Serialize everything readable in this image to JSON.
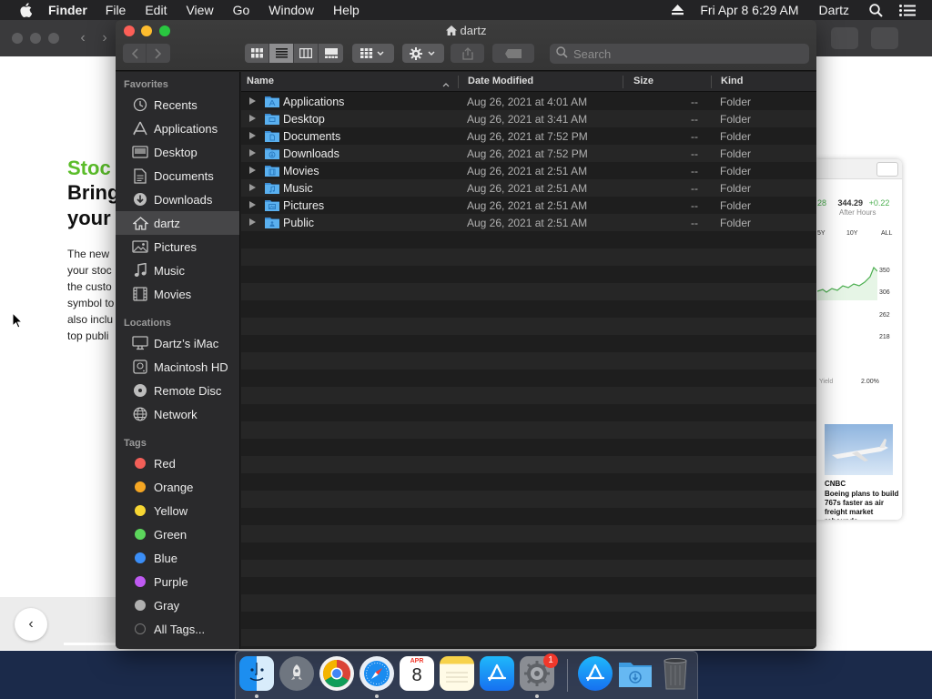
{
  "menubar": {
    "app_name": "Finder",
    "items": [
      "File",
      "Edit",
      "View",
      "Go",
      "Window",
      "Help"
    ],
    "clock": "Fri Apr 8  6:29 AM",
    "user": "Dartz"
  },
  "background_page": {
    "kicker": "Stoc",
    "headline_1": "Bring",
    "headline_2": "your",
    "body_lines": [
      "The new",
      "your stoc",
      "the custo",
      "symbol to",
      "also inclu",
      "top publi"
    ],
    "back_arrow": "‹",
    "stock_card": {
      "change_left": "28",
      "price": "344.29",
      "change": "+0.22",
      "after_hours": "After Hours",
      "ranges": [
        "5Y",
        "10Y",
        "ALL"
      ],
      "y_ticks": [
        "350",
        "306",
        "262",
        "218"
      ],
      "yield_label": "Yield",
      "yield_value": "2.00%",
      "news_source": "CNBC",
      "news_headline": "Boeing plans to build 767s faster as air freight market rebounds"
    }
  },
  "finder": {
    "window_title": "dartz",
    "search_placeholder": "Search",
    "sidebar": {
      "favorites_header": "Favorites",
      "favorites": [
        {
          "label": "Recents",
          "icon": "clock-icon"
        },
        {
          "label": "Applications",
          "icon": "applications-icon"
        },
        {
          "label": "Desktop",
          "icon": "desktop-icon"
        },
        {
          "label": "Documents",
          "icon": "document-icon"
        },
        {
          "label": "Downloads",
          "icon": "download-icon"
        },
        {
          "label": "dartz",
          "icon": "home-icon",
          "selected": true
        },
        {
          "label": "Pictures",
          "icon": "pictures-icon"
        },
        {
          "label": "Music",
          "icon": "music-icon"
        },
        {
          "label": "Movies",
          "icon": "movies-icon"
        }
      ],
      "locations_header": "Locations",
      "locations": [
        {
          "label": "Dartz’s iMac",
          "icon": "computer-icon"
        },
        {
          "label": "Macintosh HD",
          "icon": "disk-icon"
        },
        {
          "label": "Remote Disc",
          "icon": "disc-icon"
        },
        {
          "label": "Network",
          "icon": "globe-icon"
        }
      ],
      "tags_header": "Tags",
      "tags": [
        {
          "label": "Red",
          "color": "#f25f58"
        },
        {
          "label": "Orange",
          "color": "#f5a623"
        },
        {
          "label": "Yellow",
          "color": "#f7d633"
        },
        {
          "label": "Green",
          "color": "#5cd65c"
        },
        {
          "label": "Blue",
          "color": "#3b8ef7"
        },
        {
          "label": "Purple",
          "color": "#bf5af2"
        },
        {
          "label": "Gray",
          "color": "#b0b0b0"
        },
        {
          "label": "All Tags...",
          "color": "#555555"
        }
      ]
    },
    "columns": {
      "name": "Name",
      "date": "Date Modified",
      "size": "Size",
      "kind": "Kind"
    },
    "rows": [
      {
        "name": "Applications",
        "date": "Aug 26, 2021 at 4:01 AM",
        "size": "--",
        "kind": "Folder"
      },
      {
        "name": "Desktop",
        "date": "Aug 26, 2021 at 3:41 AM",
        "size": "--",
        "kind": "Folder"
      },
      {
        "name": "Documents",
        "date": "Aug 26, 2021 at 7:52 PM",
        "size": "--",
        "kind": "Folder"
      },
      {
        "name": "Downloads",
        "date": "Aug 26, 2021 at 7:52 PM",
        "size": "--",
        "kind": "Folder"
      },
      {
        "name": "Movies",
        "date": "Aug 26, 2021 at 2:51 AM",
        "size": "--",
        "kind": "Folder"
      },
      {
        "name": "Music",
        "date": "Aug 26, 2021 at 2:51 AM",
        "size": "--",
        "kind": "Folder"
      },
      {
        "name": "Pictures",
        "date": "Aug 26, 2021 at 2:51 AM",
        "size": "--",
        "kind": "Folder"
      },
      {
        "name": "Public",
        "date": "Aug 26, 2021 at 2:51 AM",
        "size": "--",
        "kind": "Folder"
      }
    ]
  },
  "dock": {
    "apps": [
      "finder-icon",
      "launchpad-icon",
      "chrome-icon",
      "safari-icon",
      "calendar-icon",
      "notes-icon",
      "app-store-icon",
      "system-preferences-icon",
      "app-store-downloads-icon",
      "downloads-folder-icon",
      "trash-icon"
    ],
    "calendar_month": "APR",
    "calendar_day": "8",
    "sysprefs_badge": "1"
  }
}
